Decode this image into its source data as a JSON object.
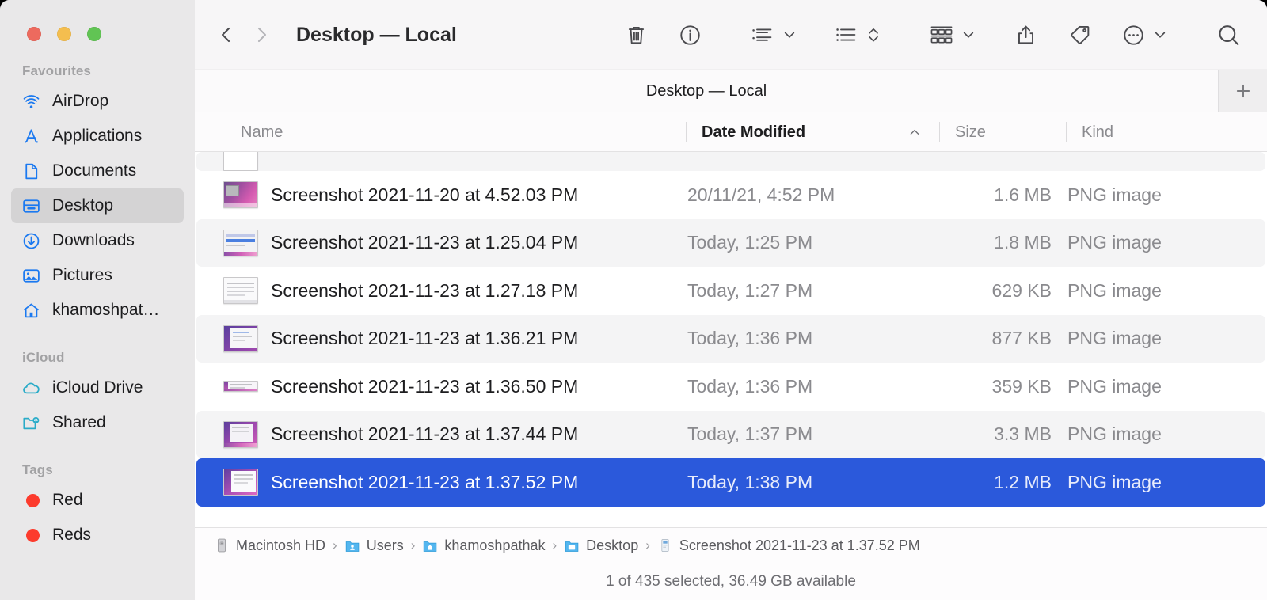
{
  "window": {
    "traffic_lights": [
      {
        "name": "close",
        "color": "#ed6a5e"
      },
      {
        "name": "minimize",
        "color": "#f4be4f"
      },
      {
        "name": "maximize",
        "color": "#61c454"
      }
    ]
  },
  "sidebar": {
    "sections": [
      {
        "title": "Favourites",
        "items": [
          {
            "label": "AirDrop",
            "icon": "airdrop-icon",
            "selected": false
          },
          {
            "label": "Applications",
            "icon": "applications-icon",
            "selected": false
          },
          {
            "label": "Documents",
            "icon": "document-icon",
            "selected": false
          },
          {
            "label": "Desktop",
            "icon": "desktop-icon",
            "selected": true
          },
          {
            "label": "Downloads",
            "icon": "download-icon",
            "selected": false
          },
          {
            "label": "Pictures",
            "icon": "pictures-icon",
            "selected": false
          },
          {
            "label": "khamoshpat…",
            "icon": "home-icon",
            "selected": false
          }
        ]
      },
      {
        "title": "iCloud",
        "items": [
          {
            "label": "iCloud Drive",
            "icon": "cloud-icon",
            "selected": false
          },
          {
            "label": "Shared",
            "icon": "shared-folder-icon",
            "selected": false
          }
        ]
      },
      {
        "title": "Tags",
        "items": [
          {
            "label": "Red",
            "icon": "tag-dot-icon",
            "color": "#fc3b2d",
            "selected": false
          },
          {
            "label": "Reds",
            "icon": "tag-dot-icon",
            "color": "#fc3b2d",
            "selected": false
          }
        ]
      }
    ]
  },
  "toolbar": {
    "back_icon": "chevron-left-icon",
    "forward_icon": "chevron-right-icon",
    "title": "Desktop — Local",
    "buttons": [
      {
        "name": "delete-button",
        "icon": "trash-icon"
      },
      {
        "name": "info-button",
        "icon": "info-circle-icon"
      },
      {
        "name": "group-by-button",
        "icon": "group-list-icon",
        "chevron": "chevron-down-icon"
      },
      {
        "name": "sort-by-button",
        "icon": "sort-list-icon",
        "chevron": "chevron-updown-icon"
      },
      {
        "name": "view-options-button",
        "icon": "gallery-view-icon",
        "chevron": "chevron-down-icon"
      },
      {
        "name": "share-button",
        "icon": "share-icon"
      },
      {
        "name": "tag-button",
        "icon": "tag-icon"
      },
      {
        "name": "more-button",
        "icon": "ellipsis-circle-icon",
        "chevron": "chevron-down-icon"
      },
      {
        "name": "search-button",
        "icon": "search-icon"
      }
    ]
  },
  "tabbar": {
    "active_tab": "Desktop — Local",
    "new_tab_icon": "plus-icon"
  },
  "columns": {
    "name": "Name",
    "date_modified": "Date Modified",
    "size": "Size",
    "kind": "Kind",
    "sorted_by": "Date Modified",
    "sort_direction_icon": "chevron-up-icon"
  },
  "files": [
    {
      "name": "Screenshot 2021-11-20 at 4.52.03 PM",
      "date": "20/11/21, 4:52 PM",
      "size": "1.6 MB",
      "kind": "PNG image",
      "selected": false,
      "alt": false
    },
    {
      "name": "Screenshot 2021-11-23 at 1.25.04 PM",
      "date": "Today, 1:25 PM",
      "size": "1.8 MB",
      "kind": "PNG image",
      "selected": false,
      "alt": true
    },
    {
      "name": "Screenshot 2021-11-23 at 1.27.18 PM",
      "date": "Today, 1:27 PM",
      "size": "629 KB",
      "kind": "PNG image",
      "selected": false,
      "alt": false
    },
    {
      "name": "Screenshot 2021-11-23 at 1.36.21 PM",
      "date": "Today, 1:36 PM",
      "size": "877 KB",
      "kind": "PNG image",
      "selected": false,
      "alt": true
    },
    {
      "name": "Screenshot 2021-11-23 at 1.36.50 PM",
      "date": "Today, 1:36 PM",
      "size": "359 KB",
      "kind": "PNG image",
      "selected": false,
      "alt": false
    },
    {
      "name": "Screenshot 2021-11-23 at 1.37.44 PM",
      "date": "Today, 1:37 PM",
      "size": "3.3 MB",
      "kind": "PNG image",
      "selected": false,
      "alt": true
    },
    {
      "name": "Screenshot 2021-11-23 at 1.37.52 PM",
      "date": "Today, 1:38 PM",
      "size": "1.2 MB",
      "kind": "PNG image",
      "selected": true,
      "alt": false
    }
  ],
  "pathbar": {
    "crumbs": [
      {
        "label": "Macintosh HD",
        "icon": "hard-drive-icon"
      },
      {
        "label": "Users",
        "icon": "users-folder-icon"
      },
      {
        "label": "khamoshpathak",
        "icon": "home-folder-icon"
      },
      {
        "label": "Desktop",
        "icon": "folder-icon"
      },
      {
        "label": "Screenshot 2021-11-23 at 1.37.52 PM",
        "icon": "png-file-icon"
      }
    ],
    "separator": "›"
  },
  "statusbar": {
    "text": "1 of 435 selected, 36.49 GB available"
  },
  "colors": {
    "selection_blue": "#2b59db",
    "sidebar_bg": "#e9e8e9",
    "accent_icon_blue": "#1b79f0",
    "icloud_teal": "#2aabc8"
  }
}
